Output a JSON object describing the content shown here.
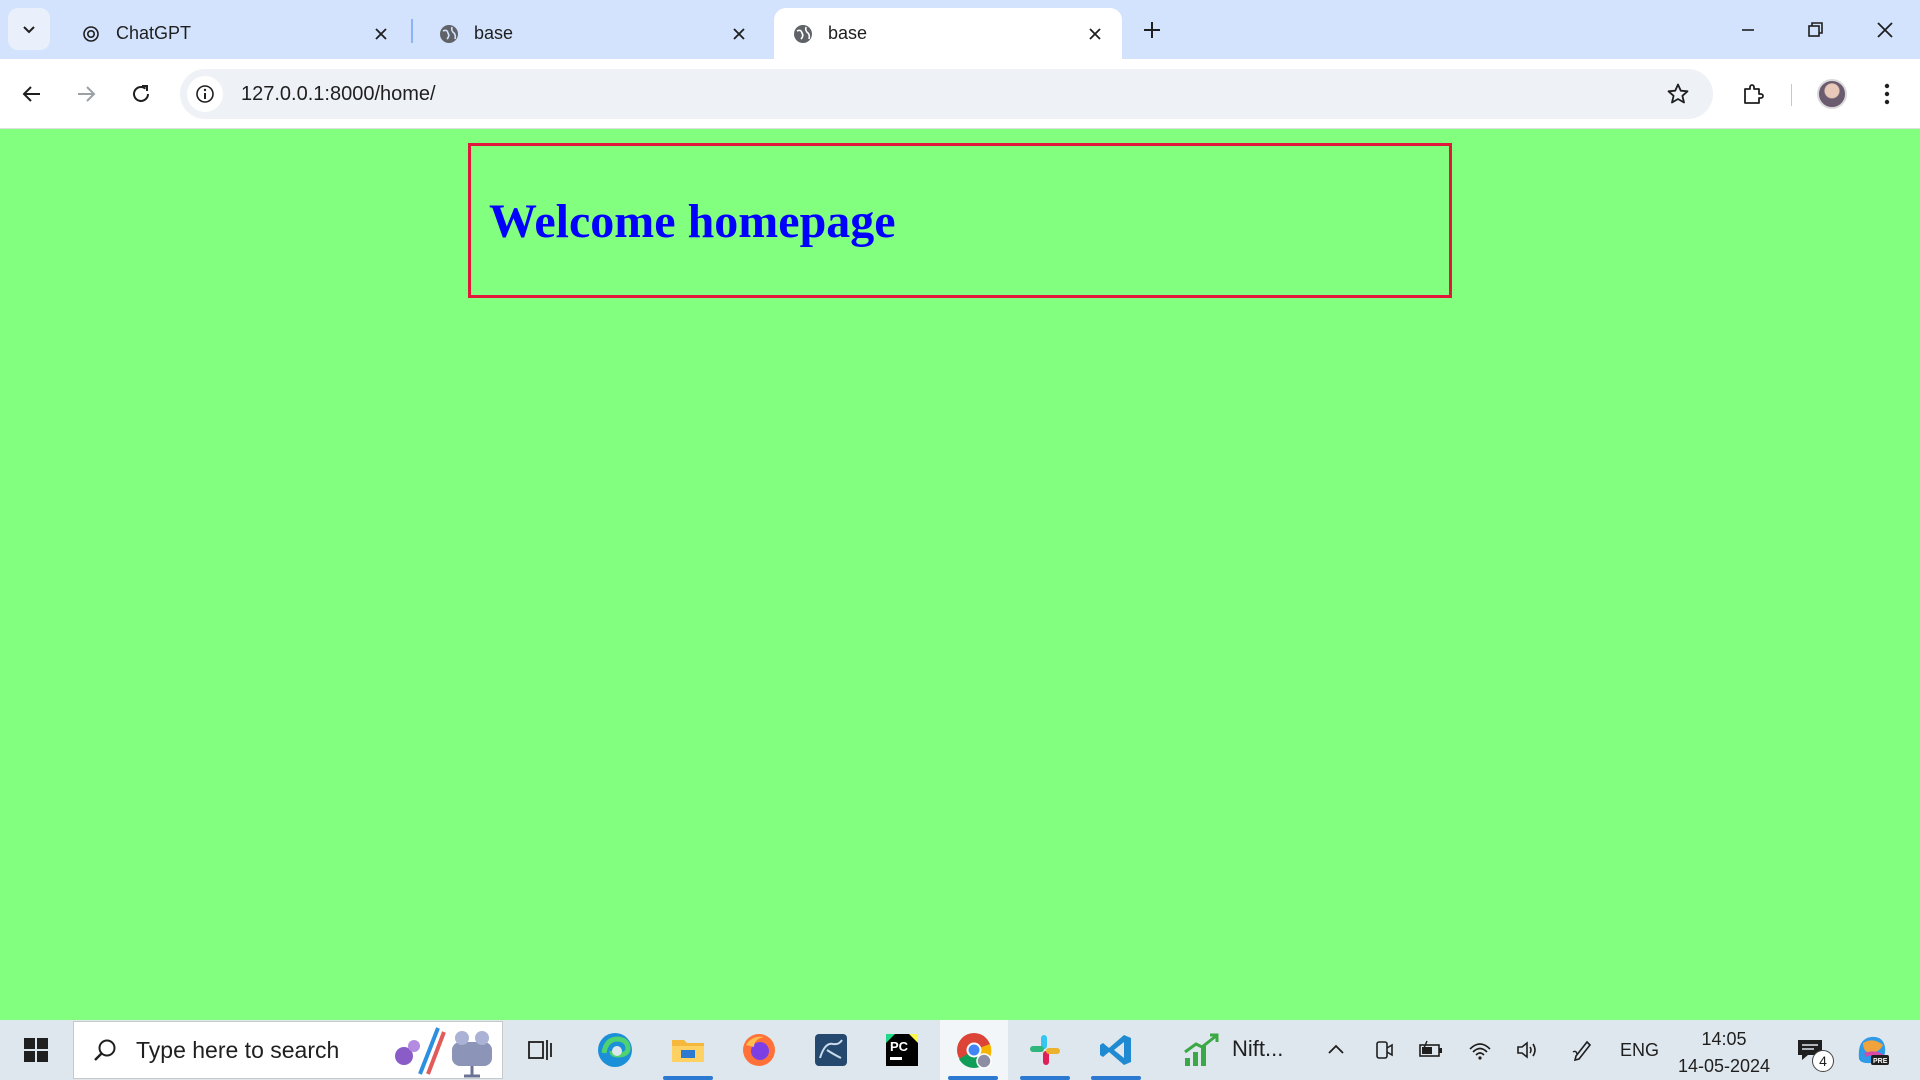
{
  "browser": {
    "tabs": [
      {
        "title": "ChatGPT",
        "icon": "openai-icon",
        "active": false
      },
      {
        "title": "base",
        "icon": "globe-icon",
        "active": false
      },
      {
        "title": "base",
        "icon": "globe-icon",
        "active": true
      }
    ],
    "address_bar": {
      "url": "127.0.0.1:8000/home/"
    }
  },
  "page": {
    "heading": "Welcome homepage",
    "background_color": "#82ff7f",
    "heading_color": "#0000ff",
    "box_border_color": "#e0163b"
  },
  "taskbar": {
    "search_placeholder": "Type here to search",
    "pinned_apps": [
      {
        "name": "task-view"
      },
      {
        "name": "edge"
      },
      {
        "name": "file-explorer"
      },
      {
        "name": "firefox"
      },
      {
        "name": "mysql-workbench"
      },
      {
        "name": "pycharm"
      },
      {
        "name": "chrome"
      },
      {
        "name": "slack"
      },
      {
        "name": "vscode"
      }
    ],
    "nifty_label": "Nift...",
    "language": "ENG",
    "time": "14:05",
    "date": "14-05-2024",
    "notification_count": "4"
  }
}
